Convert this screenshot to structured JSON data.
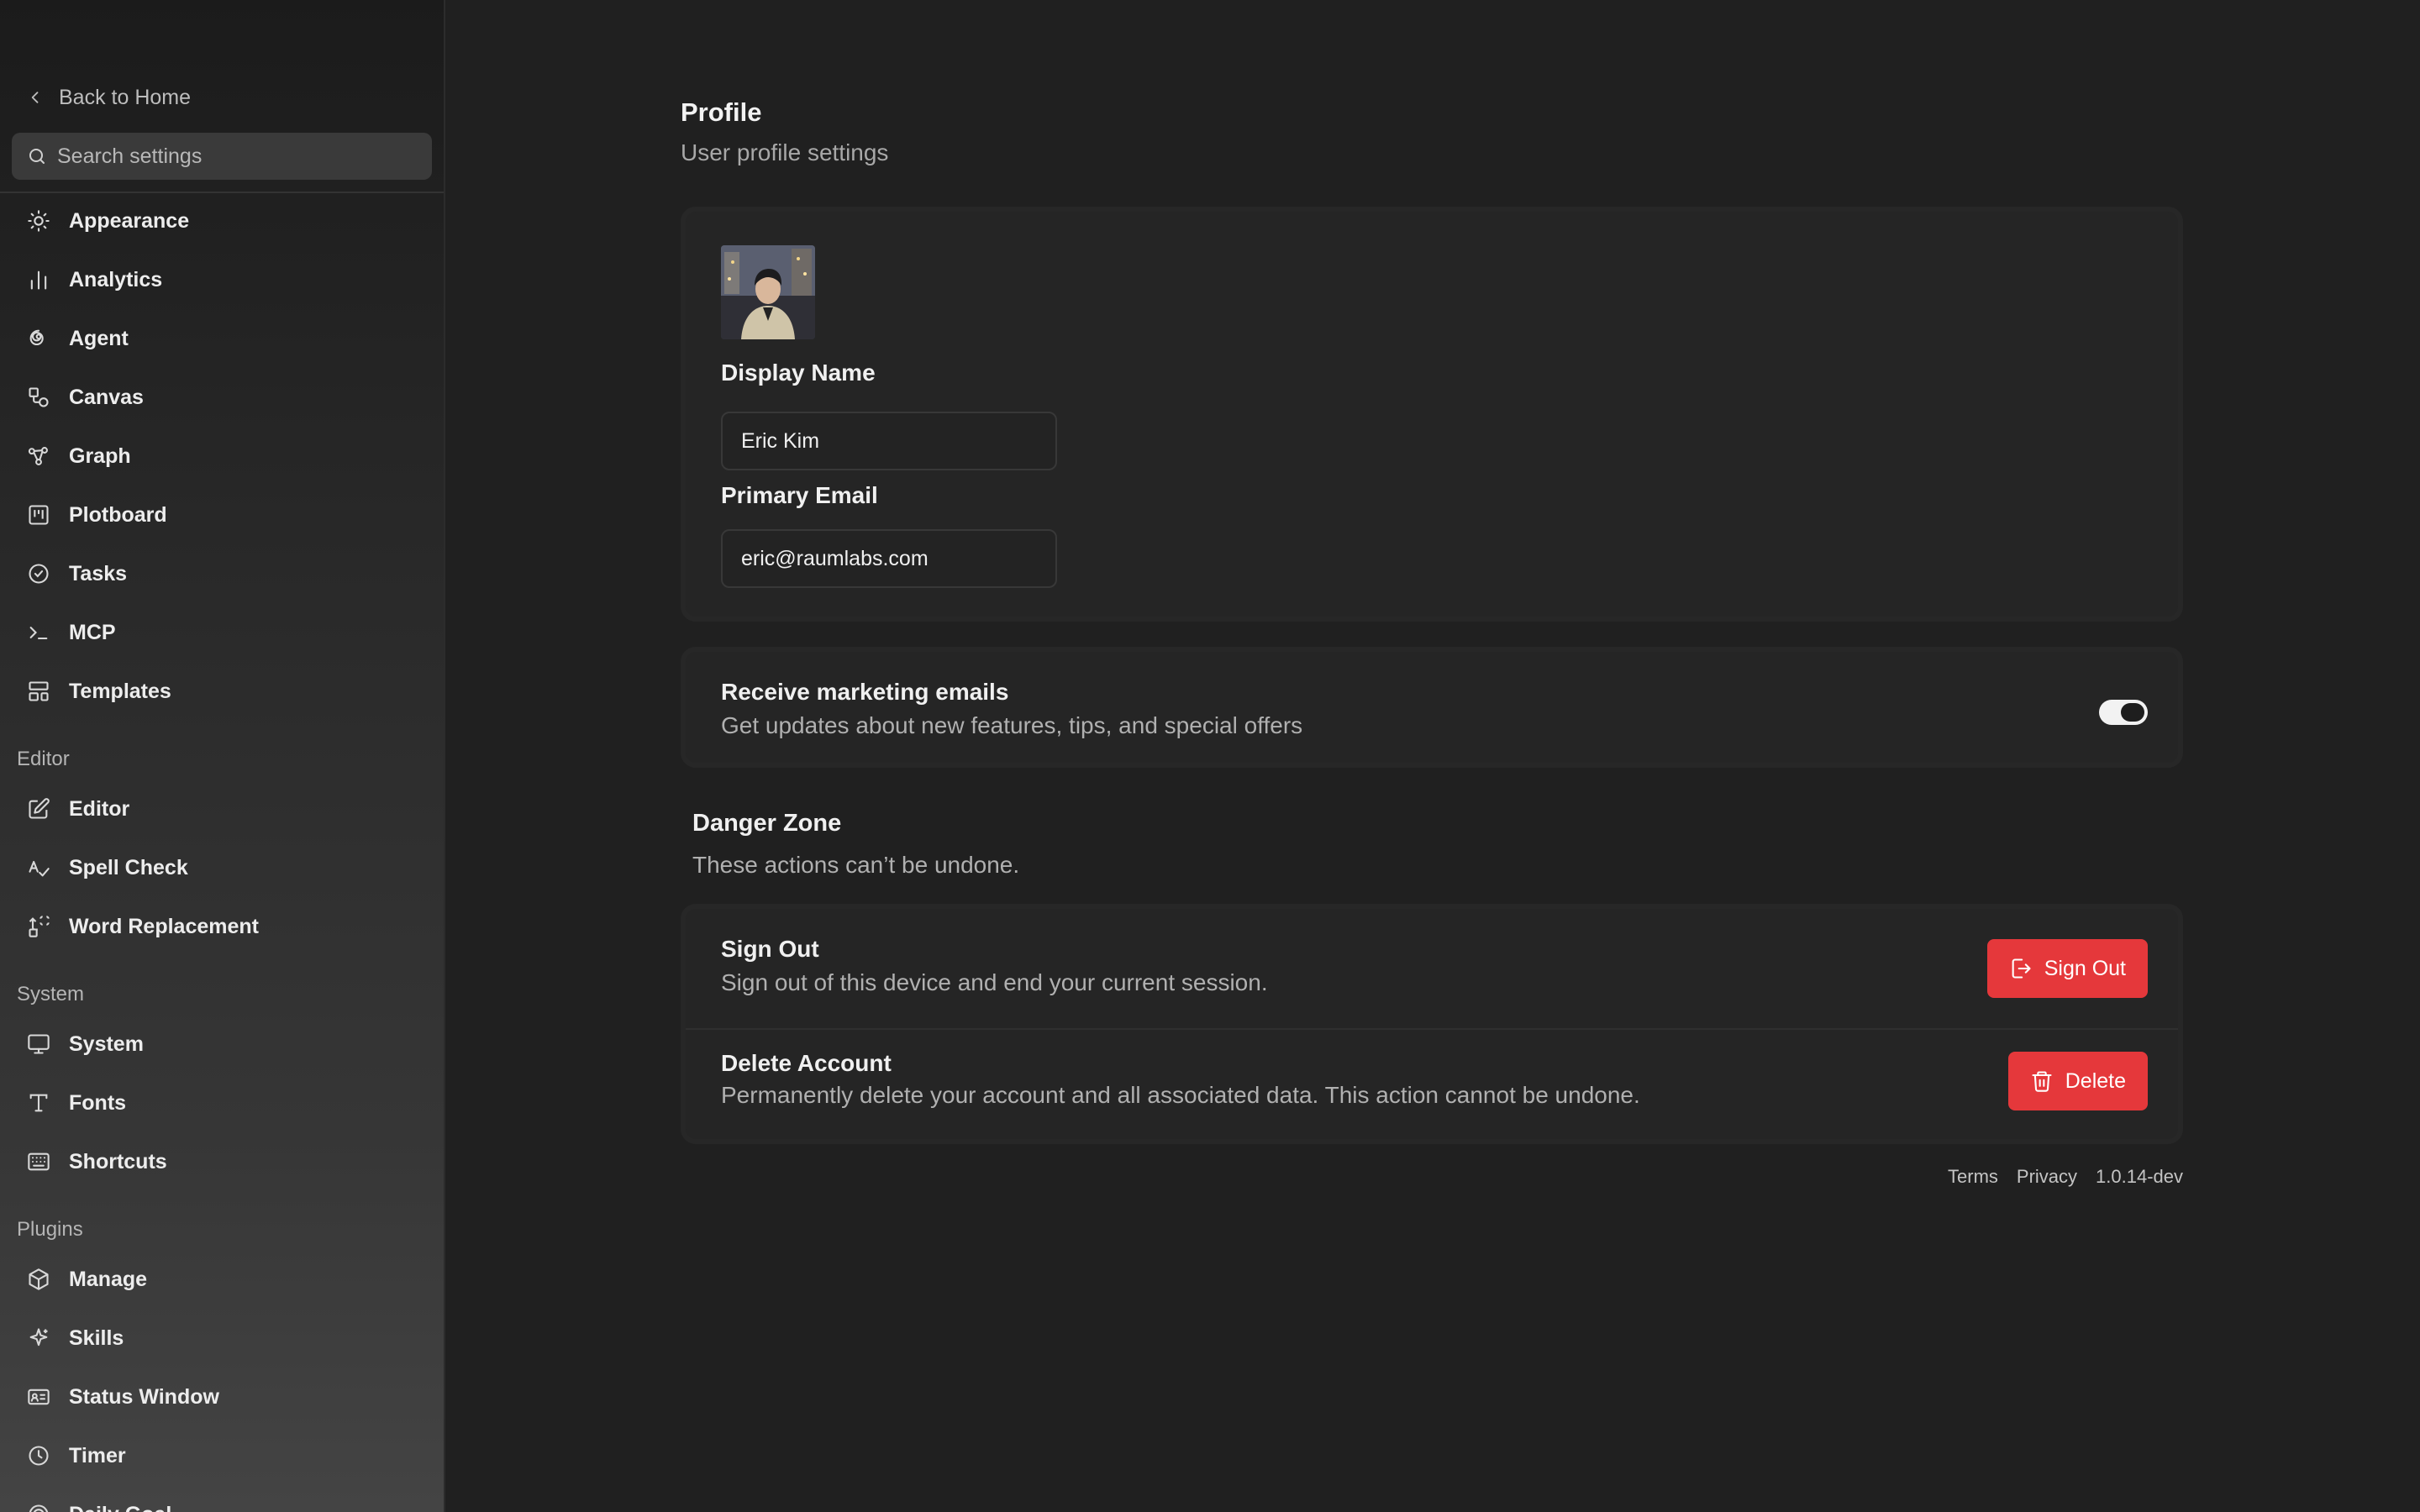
{
  "sidebar": {
    "back_label": "Back to Home",
    "search_placeholder": "Search settings",
    "items": [
      {
        "label": "Appearance",
        "icon": "sun-icon"
      },
      {
        "label": "Analytics",
        "icon": "bar-chart-icon"
      },
      {
        "label": "Agent",
        "icon": "spiral-icon"
      },
      {
        "label": "Canvas",
        "icon": "shapes-icon"
      },
      {
        "label": "Graph",
        "icon": "graph-nodes-icon"
      },
      {
        "label": "Plotboard",
        "icon": "kanban-icon"
      },
      {
        "label": "Tasks",
        "icon": "check-circle-icon"
      },
      {
        "label": "MCP",
        "icon": "terminal-icon"
      },
      {
        "label": "Templates",
        "icon": "layout-template-icon"
      }
    ],
    "sections": {
      "editor": {
        "title": "Editor",
        "items": [
          {
            "label": "Editor",
            "icon": "edit-icon"
          },
          {
            "label": "Spell Check",
            "icon": "spell-check-icon"
          },
          {
            "label": "Word Replacement",
            "icon": "replace-icon"
          }
        ]
      },
      "system": {
        "title": "System",
        "items": [
          {
            "label": "System",
            "icon": "monitor-icon"
          },
          {
            "label": "Fonts",
            "icon": "type-icon"
          },
          {
            "label": "Shortcuts",
            "icon": "keyboard-icon"
          }
        ]
      },
      "plugins": {
        "title": "Plugins",
        "items": [
          {
            "label": "Manage",
            "icon": "package-icon"
          },
          {
            "label": "Skills",
            "icon": "sparkles-icon"
          },
          {
            "label": "Status Window",
            "icon": "id-card-icon"
          },
          {
            "label": "Timer",
            "icon": "clock-icon"
          },
          {
            "label": "Daily Goal",
            "icon": "target-icon"
          }
        ]
      }
    }
  },
  "main": {
    "title": "Profile",
    "subtitle": "User profile settings",
    "profile": {
      "display_name_label": "Display Name",
      "display_name_value": "Eric Kim",
      "email_label": "Primary Email",
      "email_value": "eric@raumlabs.com"
    },
    "marketing": {
      "title": "Receive marketing emails",
      "description": "Get updates about new features, tips, and special offers",
      "enabled": true
    },
    "danger_zone": {
      "title": "Danger Zone",
      "description": "These actions can’t be undone.",
      "sign_out": {
        "title": "Sign Out",
        "description": "Sign out of this device and end your current session.",
        "button": "Sign Out"
      },
      "delete": {
        "title": "Delete Account",
        "description": "Permanently delete your account and all associated data. This action cannot be undone.",
        "button": "Delete"
      }
    },
    "footer": {
      "terms": "Terms",
      "privacy": "Privacy",
      "version": "1.0.14-dev"
    }
  },
  "colors": {
    "background": "#202020",
    "danger": "#e5383b",
    "card": "#252525"
  }
}
